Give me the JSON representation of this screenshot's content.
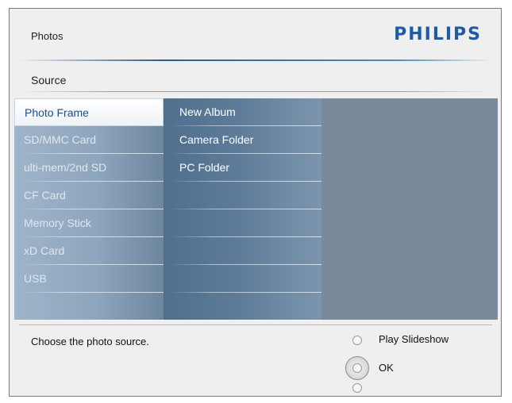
{
  "header": {
    "title": "Photos",
    "brand": "PHILIPS"
  },
  "section": {
    "title": "Source"
  },
  "source_list": {
    "items": [
      {
        "label": "Photo Frame",
        "selected": true
      },
      {
        "label": "SD/MMC Card",
        "selected": false
      },
      {
        "label": "ulti-mem/2nd SD",
        "selected": false
      },
      {
        "label": "CF Card",
        "selected": false
      },
      {
        "label": "Memory Stick",
        "selected": false
      },
      {
        "label": "xD Card",
        "selected": false
      },
      {
        "label": "USB",
        "selected": false
      },
      {
        "label": "",
        "selected": false
      }
    ]
  },
  "target_list": {
    "items": [
      {
        "label": "New Album"
      },
      {
        "label": "Camera Folder"
      },
      {
        "label": "PC Folder"
      },
      {
        "label": ""
      },
      {
        "label": ""
      },
      {
        "label": ""
      },
      {
        "label": ""
      },
      {
        "label": ""
      }
    ]
  },
  "status": {
    "text": "Choose the photo source."
  },
  "controls": {
    "play_label": "Play Slideshow",
    "ok_label": "OK",
    "icons": {
      "up": "radio-circle-icon",
      "center": "dial-button-icon",
      "down": "radio-circle-icon"
    }
  },
  "colors": {
    "brand": "#1f5aa6",
    "selected_text": "#1e4f86",
    "panel": "#7b8a9b"
  }
}
